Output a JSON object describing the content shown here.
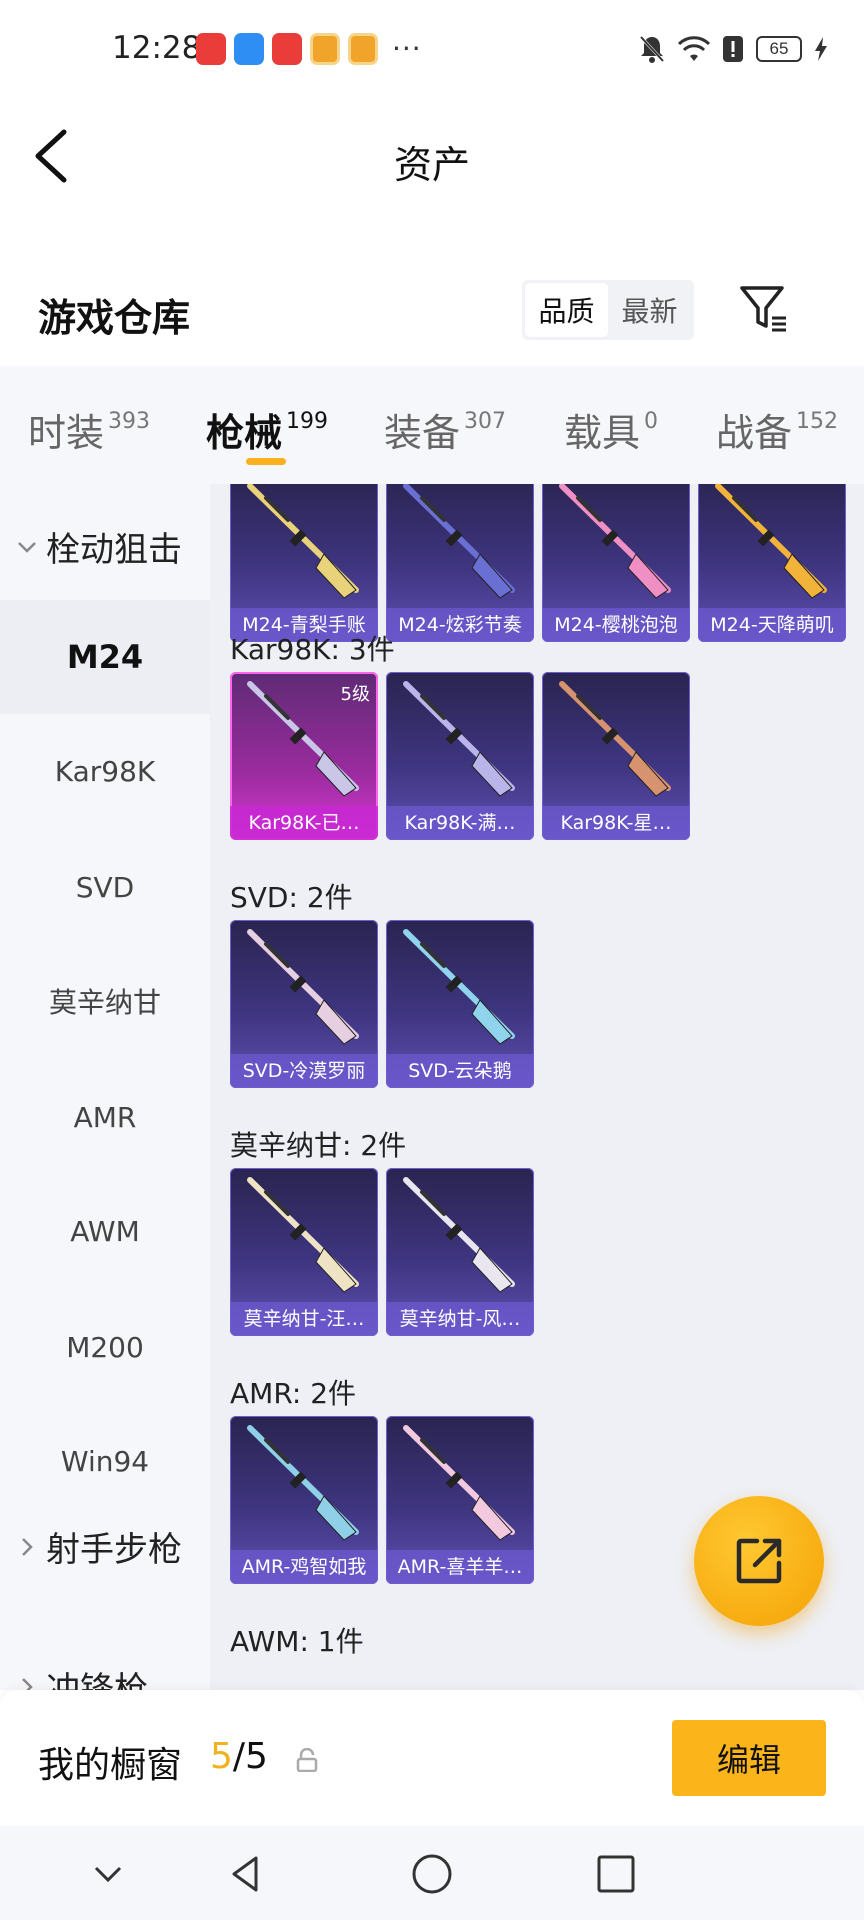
{
  "status_bar": {
    "time": "12:28",
    "more": "···",
    "battery": "65",
    "icons": [
      "huawei-app-icon",
      "cloud-app-icon",
      "huawei-app-icon",
      "game-app-icon",
      "game-app-icon",
      "mute-icon",
      "wifi-icon",
      "alert-icon",
      "battery-icon",
      "charging-icon"
    ]
  },
  "header": {
    "title": "资产"
  },
  "section": {
    "title": "游戏仓库",
    "sort_options": [
      "品质",
      "最新"
    ],
    "active_sort": "品质"
  },
  "tabs": [
    {
      "label": "时装",
      "count": "393"
    },
    {
      "label": "枪械",
      "count": "199"
    },
    {
      "label": "装备",
      "count": "307"
    },
    {
      "label": "载具",
      "count": "0"
    },
    {
      "label": "战备",
      "count": "152"
    }
  ],
  "active_tab": "枪械",
  "sidebar": {
    "categories": [
      {
        "label": "栓动狙击",
        "expanded": true
      },
      {
        "label": "射手步枪",
        "expanded": false
      },
      {
        "label": "冲锋枪",
        "expanded": false
      }
    ],
    "items": [
      "M24",
      "Kar98K",
      "SVD",
      "莫辛纳甘",
      "AMR",
      "AWM",
      "M200",
      "Win94"
    ],
    "active_item": "M24"
  },
  "groups": [
    {
      "label": "",
      "items": [
        {
          "name": "M24-青梨手账",
          "color": "#e8d27a"
        },
        {
          "name": "M24-炫彩节奏",
          "color": "#6a6fd4"
        },
        {
          "name": "M24-樱桃泡泡",
          "color": "#f08fc4"
        },
        {
          "name": "M24-天降萌叽",
          "color": "#f2b33a"
        }
      ]
    },
    {
      "label": "Kar98K: 3件",
      "items": [
        {
          "name": "Kar98K-已…",
          "color": "#c9c6e8",
          "level": "5级",
          "gold": true
        },
        {
          "name": "Kar98K-满…",
          "color": "#b9b4ea"
        },
        {
          "name": "Kar98K-星…",
          "color": "#d79270"
        }
      ]
    },
    {
      "label": "SVD: 2件",
      "items": [
        {
          "name": "SVD-冷漠罗丽",
          "color": "#e6cfe0"
        },
        {
          "name": "SVD-云朵鹅",
          "color": "#8fd3ec"
        }
      ]
    },
    {
      "label": "莫辛纳甘: 2件",
      "items": [
        {
          "name": "莫辛纳甘-汪…",
          "color": "#efe3c6"
        },
        {
          "name": "莫辛纳甘-风…",
          "color": "#e9e6ef"
        }
      ]
    },
    {
      "label": "AMR: 2件",
      "items": [
        {
          "name": "AMR-鸡智如我",
          "color": "#8fd0e8"
        },
        {
          "name": "AMR-喜羊羊…",
          "color": "#f2c9df"
        }
      ]
    },
    {
      "label": "AWM: 1件",
      "items": []
    }
  ],
  "bottom_bar": {
    "label": "我的橱窗",
    "current": "5",
    "separator": "/",
    "total": "5",
    "edit_label": "编辑"
  },
  "accent_color": "#f8b11c"
}
